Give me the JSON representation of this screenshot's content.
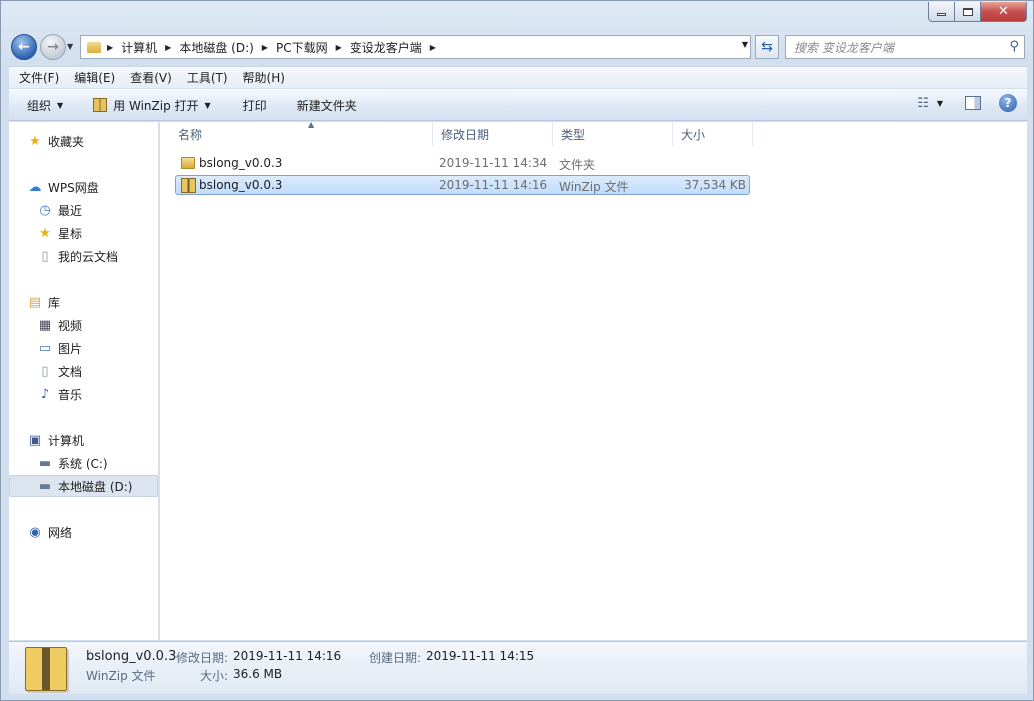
{
  "window": {
    "caption": {
      "minimize": "–",
      "close": "✕"
    }
  },
  "address": {
    "crumbs": [
      "计算机",
      "本地磁盘 (D:)",
      "PC下载网",
      "变设龙客户端"
    ],
    "search_placeholder": "搜索 变设龙客户端"
  },
  "menu": [
    "文件(F)",
    "编辑(E)",
    "查看(V)",
    "工具(T)",
    "帮助(H)"
  ],
  "commands": {
    "organize": "组织",
    "open_with": "用 WinZip 打开",
    "print": "打印",
    "new_folder": "新建文件夹"
  },
  "nav": {
    "favorites": "收藏夹",
    "wps": "WPS网盘",
    "wps_recent": "最近",
    "wps_star": "星标",
    "wps_docs": "我的云文档",
    "library": "库",
    "lib_video": "视频",
    "lib_pictures": "图片",
    "lib_docs": "文档",
    "lib_music": "音乐",
    "computer": "计算机",
    "drive_c": "系统 (C:)",
    "drive_d": "本地磁盘 (D:)",
    "network": "网络"
  },
  "columns": {
    "name": "名称",
    "modified": "修改日期",
    "type": "类型",
    "size": "大小"
  },
  "files": [
    {
      "name": "bslong_v0.0.3",
      "modified": "2019-11-11 14:34",
      "type": "文件夹",
      "size": "",
      "icon": "folder-icon"
    },
    {
      "name": "bslong_v0.0.3",
      "modified": "2019-11-11 14:16",
      "type": "WinZip 文件",
      "size": "37,534 KB",
      "icon": "winzip-icon",
      "selected": true
    }
  ],
  "details": {
    "name": "bslong_v0.0.3",
    "type": "WinZip 文件",
    "modified_label": "修改日期:",
    "modified_value": "2019-11-11 14:16",
    "created_label": "创建日期:",
    "created_value": "2019-11-11 14:15",
    "size_label": "大小:",
    "size_value": "36.6 MB"
  },
  "colors": {
    "accent": "#2f64b1",
    "selection": "#c1dcfc"
  }
}
